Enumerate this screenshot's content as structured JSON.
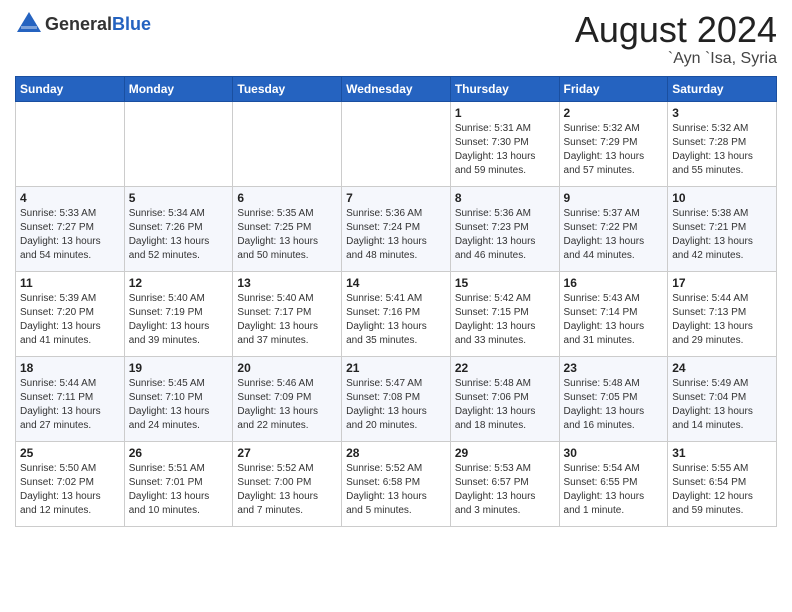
{
  "header": {
    "logo_general": "General",
    "logo_blue": "Blue",
    "month_year": "August 2024",
    "location": "`Ayn `Isa, Syria"
  },
  "days_of_week": [
    "Sunday",
    "Monday",
    "Tuesday",
    "Wednesday",
    "Thursday",
    "Friday",
    "Saturday"
  ],
  "weeks": [
    [
      {
        "day": "",
        "info": ""
      },
      {
        "day": "",
        "info": ""
      },
      {
        "day": "",
        "info": ""
      },
      {
        "day": "",
        "info": ""
      },
      {
        "day": "1",
        "info": "Sunrise: 5:31 AM\nSunset: 7:30 PM\nDaylight: 13 hours\nand 59 minutes."
      },
      {
        "day": "2",
        "info": "Sunrise: 5:32 AM\nSunset: 7:29 PM\nDaylight: 13 hours\nand 57 minutes."
      },
      {
        "day": "3",
        "info": "Sunrise: 5:32 AM\nSunset: 7:28 PM\nDaylight: 13 hours\nand 55 minutes."
      }
    ],
    [
      {
        "day": "4",
        "info": "Sunrise: 5:33 AM\nSunset: 7:27 PM\nDaylight: 13 hours\nand 54 minutes."
      },
      {
        "day": "5",
        "info": "Sunrise: 5:34 AM\nSunset: 7:26 PM\nDaylight: 13 hours\nand 52 minutes."
      },
      {
        "day": "6",
        "info": "Sunrise: 5:35 AM\nSunset: 7:25 PM\nDaylight: 13 hours\nand 50 minutes."
      },
      {
        "day": "7",
        "info": "Sunrise: 5:36 AM\nSunset: 7:24 PM\nDaylight: 13 hours\nand 48 minutes."
      },
      {
        "day": "8",
        "info": "Sunrise: 5:36 AM\nSunset: 7:23 PM\nDaylight: 13 hours\nand 46 minutes."
      },
      {
        "day": "9",
        "info": "Sunrise: 5:37 AM\nSunset: 7:22 PM\nDaylight: 13 hours\nand 44 minutes."
      },
      {
        "day": "10",
        "info": "Sunrise: 5:38 AM\nSunset: 7:21 PM\nDaylight: 13 hours\nand 42 minutes."
      }
    ],
    [
      {
        "day": "11",
        "info": "Sunrise: 5:39 AM\nSunset: 7:20 PM\nDaylight: 13 hours\nand 41 minutes."
      },
      {
        "day": "12",
        "info": "Sunrise: 5:40 AM\nSunset: 7:19 PM\nDaylight: 13 hours\nand 39 minutes."
      },
      {
        "day": "13",
        "info": "Sunrise: 5:40 AM\nSunset: 7:17 PM\nDaylight: 13 hours\nand 37 minutes."
      },
      {
        "day": "14",
        "info": "Sunrise: 5:41 AM\nSunset: 7:16 PM\nDaylight: 13 hours\nand 35 minutes."
      },
      {
        "day": "15",
        "info": "Sunrise: 5:42 AM\nSunset: 7:15 PM\nDaylight: 13 hours\nand 33 minutes."
      },
      {
        "day": "16",
        "info": "Sunrise: 5:43 AM\nSunset: 7:14 PM\nDaylight: 13 hours\nand 31 minutes."
      },
      {
        "day": "17",
        "info": "Sunrise: 5:44 AM\nSunset: 7:13 PM\nDaylight: 13 hours\nand 29 minutes."
      }
    ],
    [
      {
        "day": "18",
        "info": "Sunrise: 5:44 AM\nSunset: 7:11 PM\nDaylight: 13 hours\nand 27 minutes."
      },
      {
        "day": "19",
        "info": "Sunrise: 5:45 AM\nSunset: 7:10 PM\nDaylight: 13 hours\nand 24 minutes."
      },
      {
        "day": "20",
        "info": "Sunrise: 5:46 AM\nSunset: 7:09 PM\nDaylight: 13 hours\nand 22 minutes."
      },
      {
        "day": "21",
        "info": "Sunrise: 5:47 AM\nSunset: 7:08 PM\nDaylight: 13 hours\nand 20 minutes."
      },
      {
        "day": "22",
        "info": "Sunrise: 5:48 AM\nSunset: 7:06 PM\nDaylight: 13 hours\nand 18 minutes."
      },
      {
        "day": "23",
        "info": "Sunrise: 5:48 AM\nSunset: 7:05 PM\nDaylight: 13 hours\nand 16 minutes."
      },
      {
        "day": "24",
        "info": "Sunrise: 5:49 AM\nSunset: 7:04 PM\nDaylight: 13 hours\nand 14 minutes."
      }
    ],
    [
      {
        "day": "25",
        "info": "Sunrise: 5:50 AM\nSunset: 7:02 PM\nDaylight: 13 hours\nand 12 minutes."
      },
      {
        "day": "26",
        "info": "Sunrise: 5:51 AM\nSunset: 7:01 PM\nDaylight: 13 hours\nand 10 minutes."
      },
      {
        "day": "27",
        "info": "Sunrise: 5:52 AM\nSunset: 7:00 PM\nDaylight: 13 hours\nand 7 minutes."
      },
      {
        "day": "28",
        "info": "Sunrise: 5:52 AM\nSunset: 6:58 PM\nDaylight: 13 hours\nand 5 minutes."
      },
      {
        "day": "29",
        "info": "Sunrise: 5:53 AM\nSunset: 6:57 PM\nDaylight: 13 hours\nand 3 minutes."
      },
      {
        "day": "30",
        "info": "Sunrise: 5:54 AM\nSunset: 6:55 PM\nDaylight: 13 hours\nand 1 minute."
      },
      {
        "day": "31",
        "info": "Sunrise: 5:55 AM\nSunset: 6:54 PM\nDaylight: 12 hours\nand 59 minutes."
      }
    ]
  ]
}
